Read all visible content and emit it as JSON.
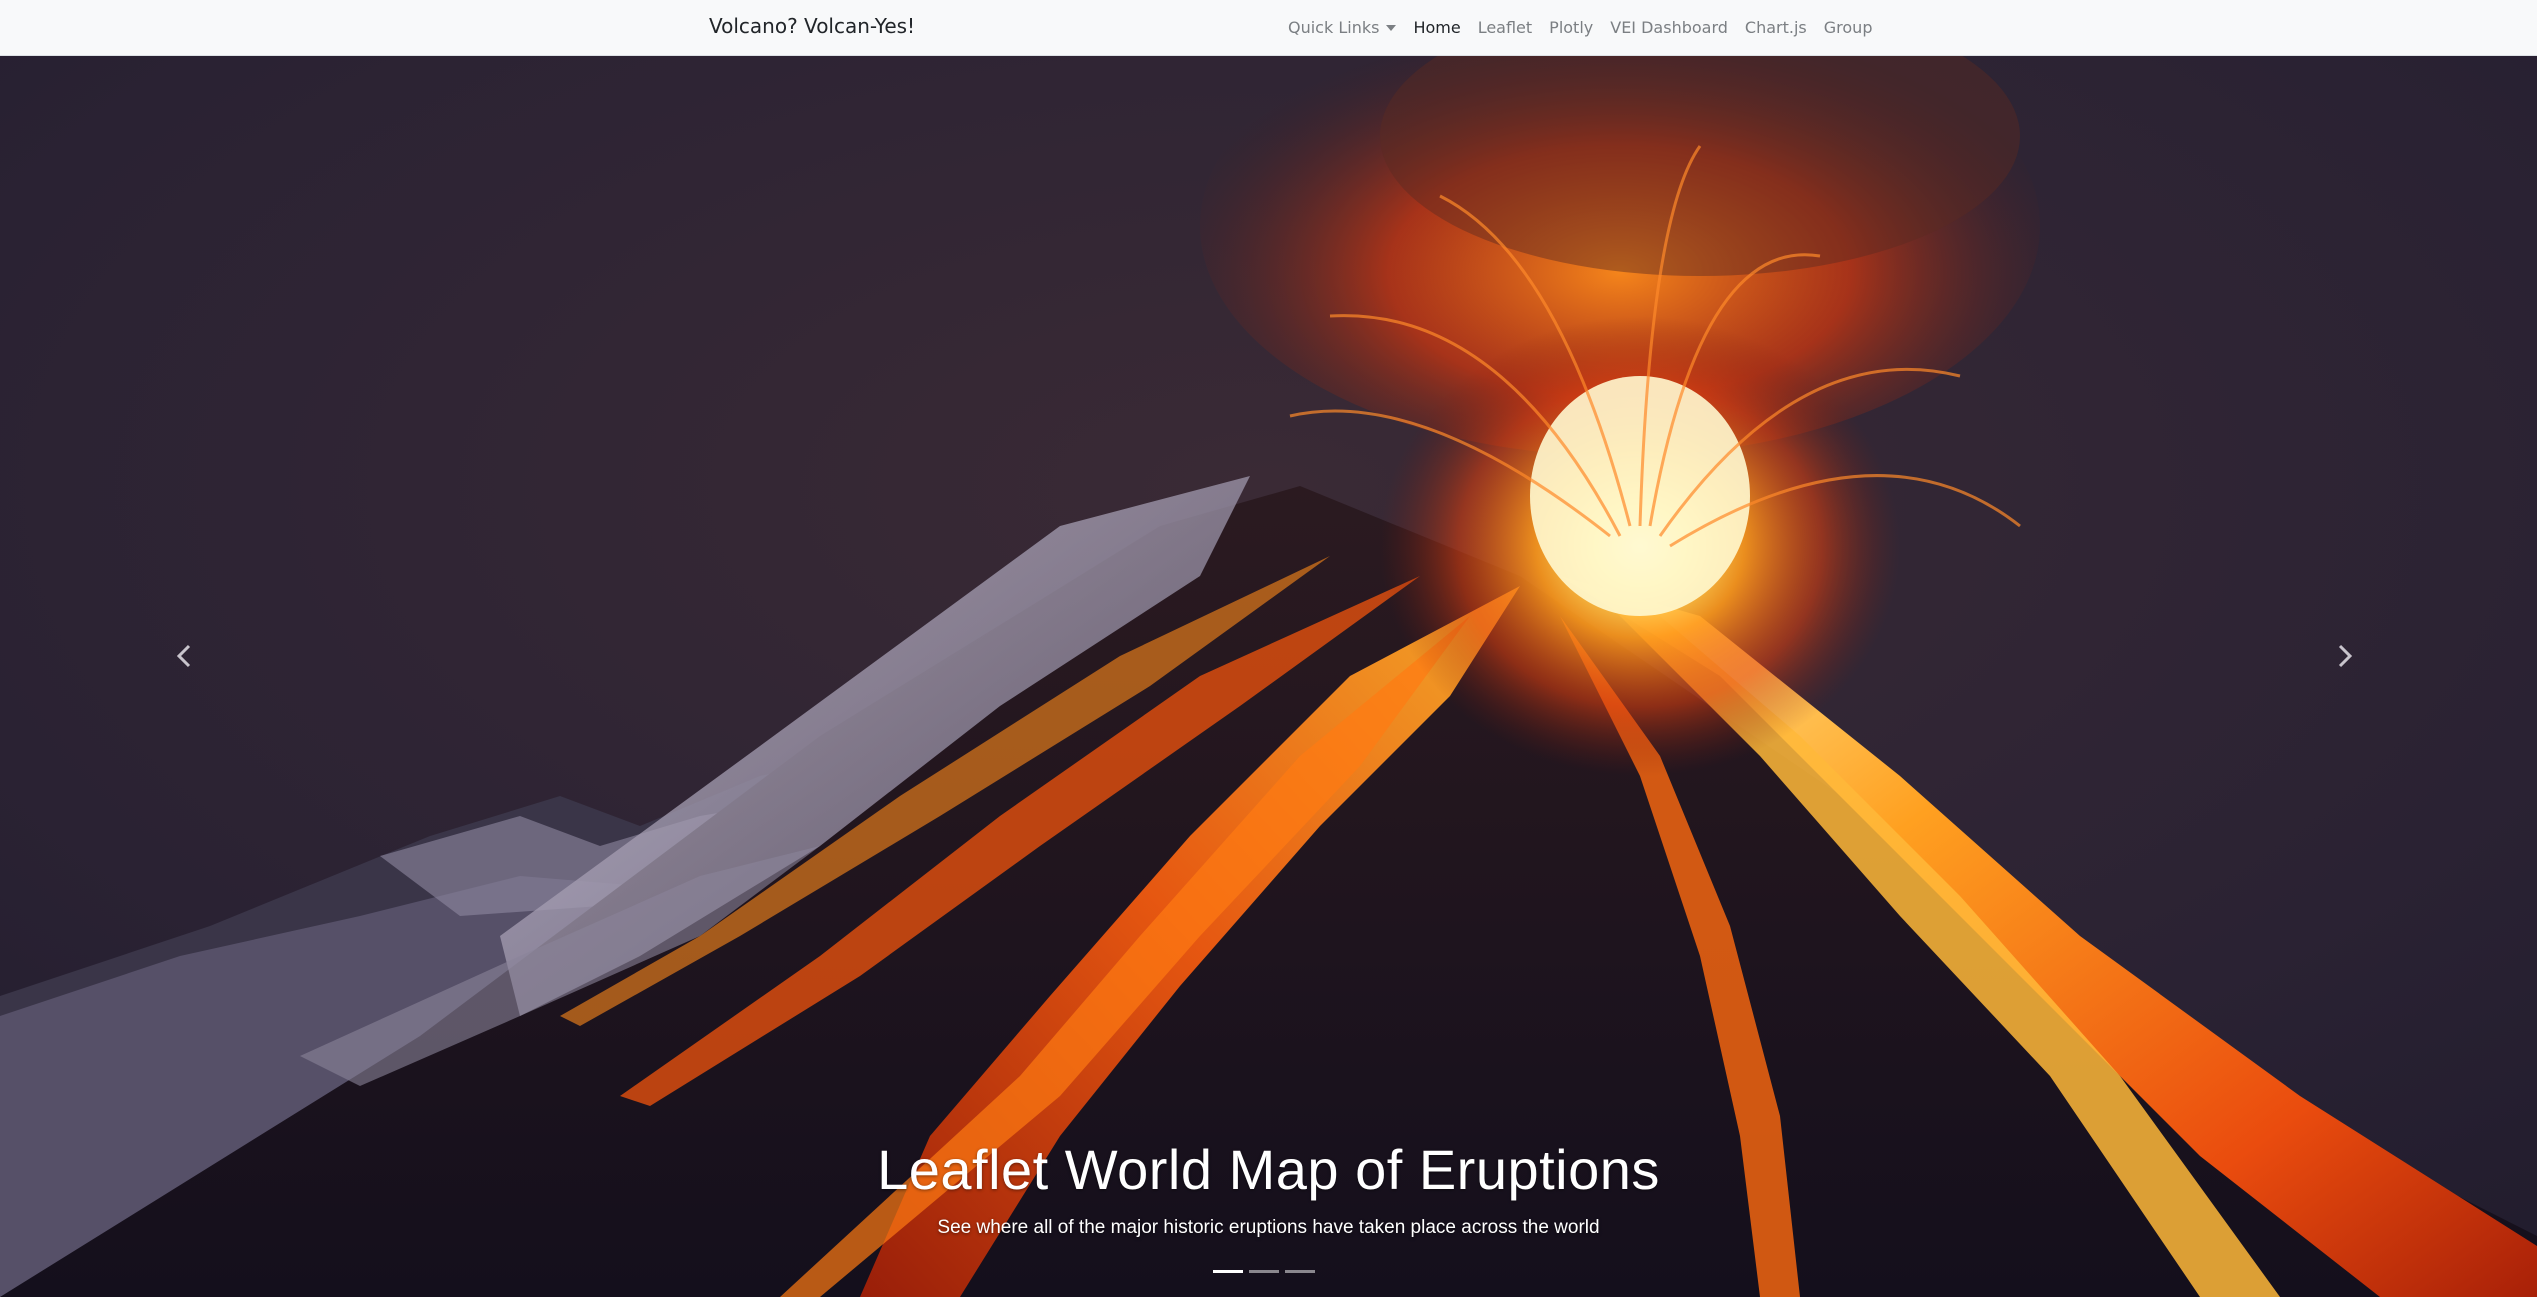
{
  "navbar": {
    "brand": "Volcano? Volcan-Yes!",
    "links": [
      {
        "label": "Quick Links",
        "dropdown": true,
        "active": false
      },
      {
        "label": "Home",
        "active": true
      },
      {
        "label": "Leaflet",
        "active": false
      },
      {
        "label": "Plotly",
        "active": false
      },
      {
        "label": "VEI Dashboard",
        "active": false
      },
      {
        "label": "Chart.js",
        "active": false
      },
      {
        "label": "Group",
        "active": false
      }
    ]
  },
  "carousel": {
    "slide": {
      "title": "Leaflet World Map of Eruptions",
      "subtitle": "See where all of the major historic eruptions have taken place across the world"
    },
    "indicators": {
      "count": 3,
      "active_index": 0
    },
    "prev_icon": "chevron-left-icon",
    "next_icon": "chevron-right-icon"
  },
  "colors": {
    "navbar_bg": "#f8f9fa",
    "sky": "#2a2233",
    "lava_core": "#fff6b0",
    "lava_mid": "#ff7a12",
    "lava_dark": "#c8260c"
  }
}
